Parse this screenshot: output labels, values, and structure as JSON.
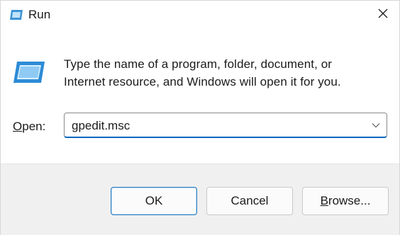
{
  "window": {
    "title": "Run",
    "close_icon": "close-icon"
  },
  "main": {
    "description_line1": "Type the name of a program, folder, document, or",
    "description_line2": "Internet resource, and Windows will open it for you.",
    "open_label_accel": "O",
    "open_label_rest": "pen:",
    "command_value": "gpedit.msc"
  },
  "buttons": {
    "ok": "OK",
    "cancel": "Cancel",
    "browse_accel": "B",
    "browse_rest": "rowse..."
  },
  "colors": {
    "accent": "#0067c0",
    "footer_bg": "#f0f0f0"
  }
}
